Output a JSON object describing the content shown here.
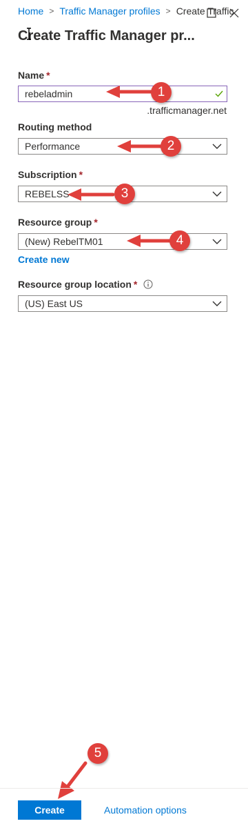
{
  "breadcrumb": {
    "home": "Home",
    "parent": "Traffic Manager profiles",
    "current": "Create Traffic"
  },
  "header": {
    "title": "Create Traffic Manager pr..."
  },
  "form": {
    "name": {
      "label": "Name",
      "required": "*",
      "value": "rebeladmin",
      "suffix": ".trafficmanager.net"
    },
    "routing": {
      "label": "Routing method",
      "value": "Performance"
    },
    "subscription": {
      "label": "Subscription",
      "required": "*",
      "value": "REBELSS"
    },
    "resource_group": {
      "label": "Resource group",
      "required": "*",
      "value": "(New) RebelTM01",
      "create_new": "Create new"
    },
    "location": {
      "label": "Resource group location",
      "required": "*",
      "value": "(US) East US"
    }
  },
  "annotations": {
    "step1": "1",
    "step2": "2",
    "step3": "3",
    "step4": "4",
    "step5": "5",
    "arrow_color": "#e0403c"
  },
  "footer": {
    "create_label": "Create",
    "automation_label": "Automation options"
  },
  "colors": {
    "accent": "#0078d4",
    "active_border": "#8764b8",
    "required": "#a4262c",
    "success": "#57a300"
  }
}
